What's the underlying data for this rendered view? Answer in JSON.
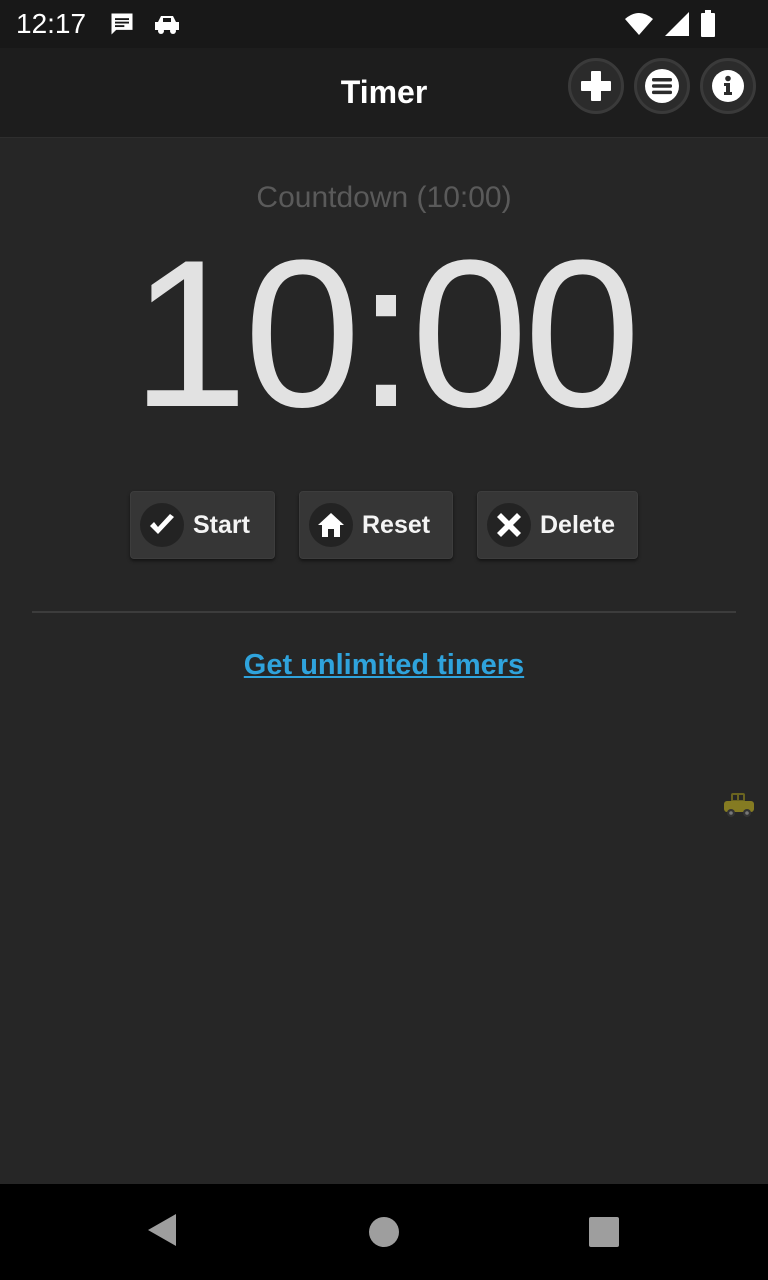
{
  "status_bar": {
    "time": "12:17",
    "icons_left": [
      "message-icon",
      "car-icon"
    ],
    "icons_right": [
      "wifi-icon",
      "signal-icon",
      "battery-icon"
    ]
  },
  "app_bar": {
    "title": "Timer",
    "actions": [
      "add-icon",
      "menu-icon",
      "info-icon"
    ]
  },
  "timer": {
    "subtitle": "Countdown (10:00)",
    "display": "10:00"
  },
  "actions": {
    "start_label": "Start",
    "reset_label": "Reset",
    "delete_label": "Delete"
  },
  "promo": {
    "link_text": "Get unlimited timers"
  },
  "nav_bar": {
    "buttons": [
      "back-icon",
      "home-icon",
      "recents-icon"
    ]
  },
  "colors": {
    "background": "#262626",
    "app_bar": "#1d1d1d",
    "link": "#2fa3dc",
    "timer_text": "#e2e2e2",
    "subtitle_text": "#5a5a5a"
  }
}
